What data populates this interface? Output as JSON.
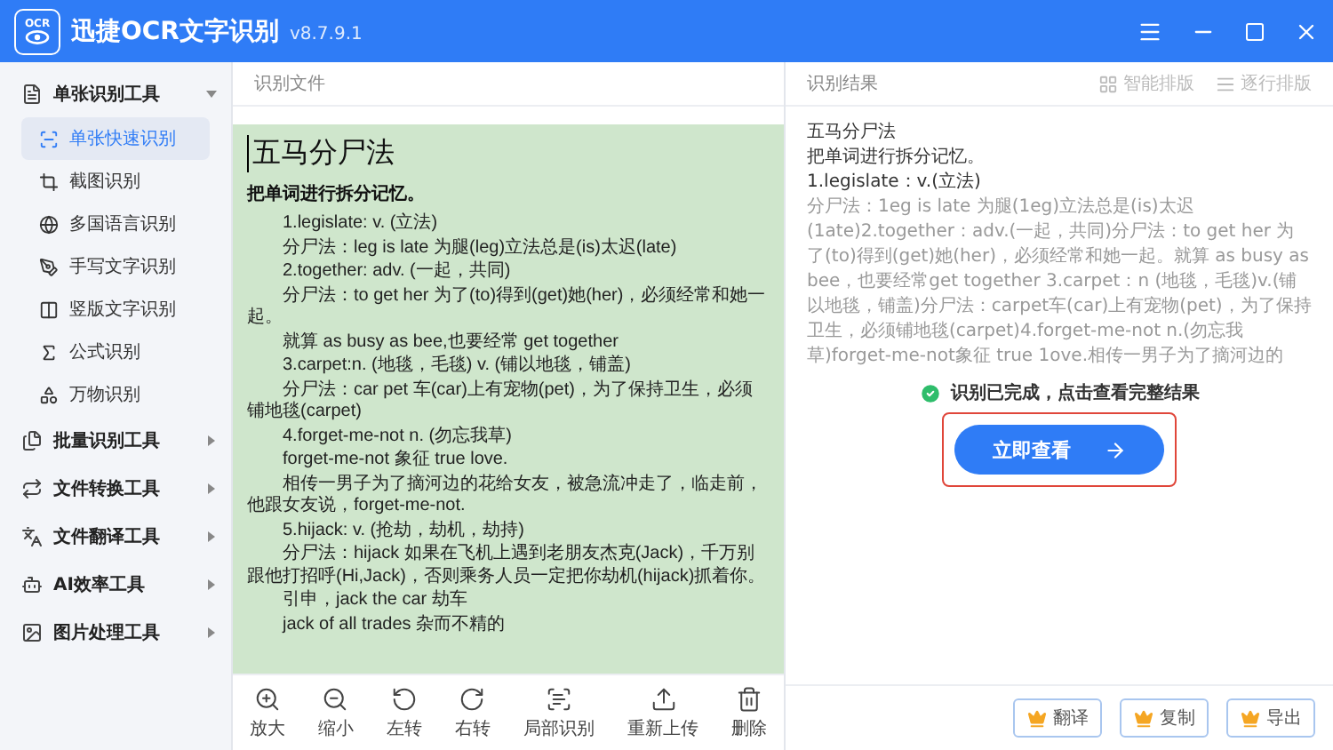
{
  "window": {
    "logo_text": "OCR",
    "app_name": "迅捷OCR文字识别",
    "version": "v8.7.9.1"
  },
  "sidebar": {
    "groups": [
      {
        "label": "单张识别工具",
        "expanded": true,
        "items": [
          {
            "label": "单张快速识别",
            "selected": true
          },
          {
            "label": "截图识别",
            "selected": false
          },
          {
            "label": "多国语言识别",
            "selected": false
          },
          {
            "label": "手写文字识别",
            "selected": false
          },
          {
            "label": "竖版文字识别",
            "selected": false
          },
          {
            "label": "公式识别",
            "selected": false
          },
          {
            "label": "万物识别",
            "selected": false
          }
        ]
      },
      {
        "label": "批量识别工具",
        "expanded": false
      },
      {
        "label": "文件转换工具",
        "expanded": false
      },
      {
        "label": "文件翻译工具",
        "expanded": false
      },
      {
        "label": "AI效率工具",
        "expanded": false
      },
      {
        "label": "图片处理工具",
        "expanded": false
      }
    ]
  },
  "source_panel": {
    "title": "识别文件",
    "document": [
      {
        "kind": "title",
        "text": "五马分尸法"
      },
      {
        "kind": "heading",
        "text": "把单词进行拆分记忆。"
      },
      {
        "kind": "para",
        "text": "1.legislate: v. (立法)"
      },
      {
        "kind": "para",
        "text": "分尸法：leg is late 为腿(leg)立法总是(is)太迟(late)"
      },
      {
        "kind": "para",
        "text": "2.together: adv. (一起，共同)"
      },
      {
        "kind": "para",
        "text": "分尸法：to get her 为了(to)得到(get)她(her)，必须经常和她一起。"
      },
      {
        "kind": "para",
        "text": "就算 as busy as bee,也要经常 get together"
      },
      {
        "kind": "para",
        "text": "3.carpet:n. (地毯，毛毯) v. (铺以地毯，铺盖)"
      },
      {
        "kind": "para",
        "text": "分尸法：car pet 车(car)上有宠物(pet)，为了保持卫生，必须铺地毯(carpet)"
      },
      {
        "kind": "para",
        "text": "4.forget-me-not n. (勿忘我草)"
      },
      {
        "kind": "para",
        "text": "forget-me-not 象征 true love."
      },
      {
        "kind": "para",
        "text": "相传一男子为了摘河边的花给女友，被急流冲走了，临走前，他跟女友说，forget-me-not."
      },
      {
        "kind": "para",
        "text": "5.hijack: v. (抢劫，劫机，劫持)"
      },
      {
        "kind": "para",
        "text": "分尸法：hijack 如果在飞机上遇到老朋友杰克(Jack)，千万别跟他打招呼(Hi,Jack)，否则乘务人员一定把你劫机(hijack)抓着你。"
      },
      {
        "kind": "para",
        "text": "引申，jack the car 劫车"
      },
      {
        "kind": "para",
        "text": "jack of all trades 杂而不精的"
      }
    ],
    "toolbar": [
      {
        "label": "放大"
      },
      {
        "label": "缩小"
      },
      {
        "label": "左转"
      },
      {
        "label": "右转"
      },
      {
        "label": "局部识别"
      },
      {
        "label": "重新上传"
      },
      {
        "label": "删除"
      }
    ]
  },
  "result_panel": {
    "title": "识别结果",
    "layout_buttons": [
      {
        "label": "智能排版"
      },
      {
        "label": "逐行排版"
      }
    ],
    "preview": [
      "五马分尸法",
      "把单词进行拆分记忆。",
      "1.legislate：v.(立法)",
      "分尸法：1eg is late 为腿(1eg)立法总是(is)太迟(1ate)2.together：adv.(一起，共同)分尸法：to get her 为了(to)得到(get)她(her)，必须经常和她一起。就算 as busy as bee，也要经常get together 3.carpet：n (地毯，毛毯)v.(铺以地毯，铺盖)分尸法：carpet车(car)上有宠物(pet)，为了保持卫生，必须铺地毯(carpet)4.forget-me-not n.(勿忘我草)forget-me-not象征 true 1ove.相传一男子为了摘河边的"
    ],
    "status": "识别已完成，点击查看完整结果",
    "view_button": "立即查看",
    "actions": [
      {
        "label": "翻译"
      },
      {
        "label": "复制"
      },
      {
        "label": "导出"
      }
    ]
  }
}
